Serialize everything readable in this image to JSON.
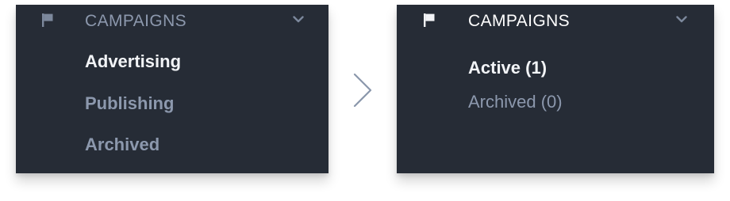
{
  "colors": {
    "panel_bg": "#262c36",
    "header_muted_text": "#8c98ad",
    "header_bright_text": "#ffffff",
    "item_active_text": "#f2f4f7",
    "item_inactive_text": "#8c98ad",
    "icon_muted": "#7c889c",
    "icon_bright": "#f2f4f7",
    "arrow": "#8a97ab"
  },
  "before_panel": {
    "header": {
      "icon": "flag-icon",
      "title": "CAMPAIGNS",
      "toggle_icon": "chevron-down-icon"
    },
    "items": [
      {
        "label": "Advertising",
        "state": "active"
      },
      {
        "label": "Publishing",
        "state": "inactive"
      },
      {
        "label": "Archived",
        "state": "inactive"
      }
    ]
  },
  "transition": {
    "icon": "chevron-right-icon"
  },
  "after_panel": {
    "header": {
      "icon": "flag-icon",
      "title": "CAMPAIGNS",
      "toggle_icon": "chevron-down-icon"
    },
    "items": [
      {
        "label": "Active (1)",
        "state": "active"
      },
      {
        "label": "Archived (0)",
        "state": "inactive"
      }
    ]
  }
}
